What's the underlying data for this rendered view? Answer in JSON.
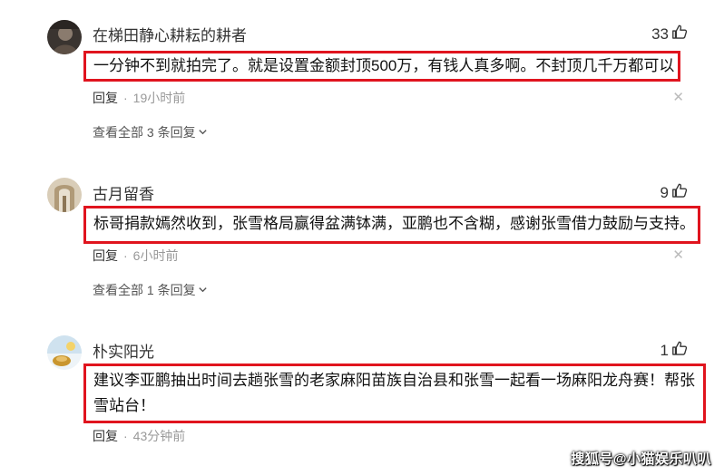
{
  "comments": [
    {
      "username": "在梯田静心耕耘的耕者",
      "likes": "33",
      "text": "一分钟不到就拍完了。就是设置金额封顶500万，有钱人真多啊。不封顶几千万都可以",
      "reply_label": "回复",
      "time": "19小时前",
      "view_all": "查看全部 3 条回复"
    },
    {
      "username": "古月留香",
      "likes": "9",
      "text": "标哥捐款嫣然收到，张雪格局赢得盆满钵满，亚鹏也不含糊，感谢张雪借力鼓励与支持。",
      "reply_label": "回复",
      "time": "6小时前",
      "view_all": "查看全部 1 条回复"
    },
    {
      "username": "朴实阳光",
      "likes": "1",
      "text": "建议李亚鹏抽出时间去趟张雪的老家麻阳苗族自治县和张雪一起看一场麻阳龙舟赛！帮张雪站台！",
      "reply_label": "回复",
      "time": "43分钟前"
    }
  ],
  "separator": "·",
  "close_glyph": "✕",
  "watermark": "搜狐号@小猫娱乐叭叭",
  "highlight_color": "#e0141e"
}
